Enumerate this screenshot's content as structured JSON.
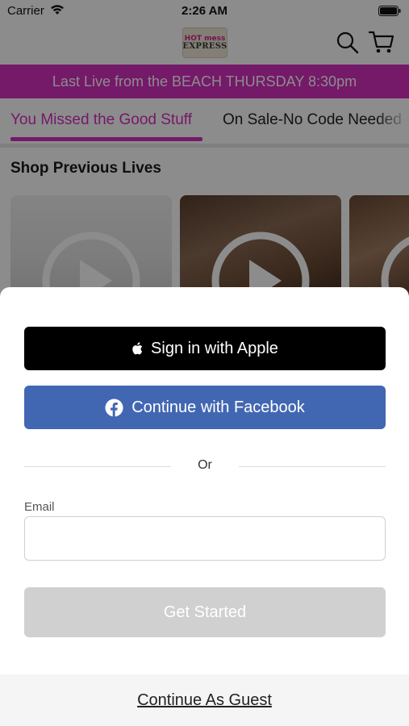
{
  "status_bar": {
    "carrier": "Carrier",
    "time": "2:26 AM",
    "icons": [
      "wifi-icon",
      "battery-icon"
    ]
  },
  "header": {
    "logo_line1": "HOT mess",
    "logo_line2": "EXPRESS",
    "icons": [
      "search-icon",
      "cart-icon"
    ]
  },
  "banner": {
    "text": "Last Live from the BEACH THURSDAY 8:30pm",
    "color": "#d62fc0"
  },
  "tabs": [
    {
      "label": "You Missed the Good Stuff",
      "active": true
    },
    {
      "label": "On Sale-No Code Needed",
      "active": false
    }
  ],
  "section": {
    "title": "Shop Previous Lives"
  },
  "sheet": {
    "apple_button": "Sign in with Apple",
    "facebook_button": "Continue with Facebook",
    "divider": "Or",
    "email_label": "Email",
    "email_value": "",
    "email_placeholder": "",
    "submit_button": "Get Started",
    "guest_link": "Continue As Guest"
  },
  "colors": {
    "accent": "#d62fc0",
    "apple_button": "#000000",
    "facebook_button": "#4267b2",
    "disabled_button": "#d0d0d0"
  }
}
